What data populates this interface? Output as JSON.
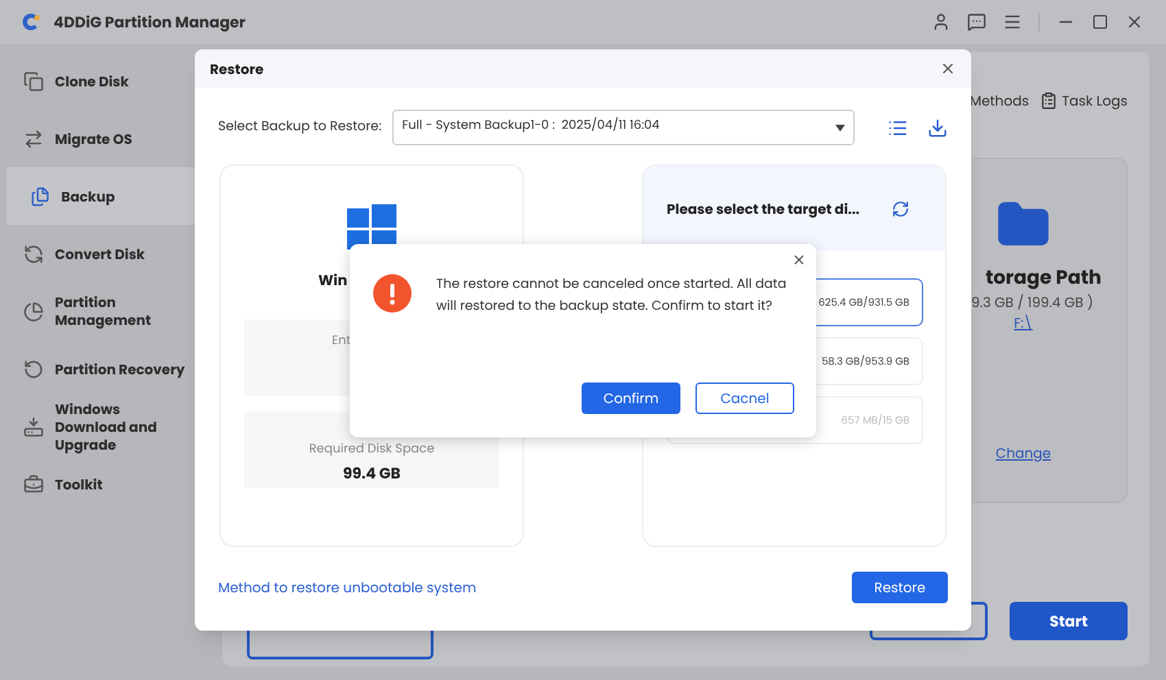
{
  "app": {
    "title": "4DDiG Partition Manager"
  },
  "sidebar": {
    "items": [
      {
        "label": "Clone Disk",
        "selected": false
      },
      {
        "label": "Migrate OS",
        "selected": false
      },
      {
        "label": "Backup",
        "selected": true
      },
      {
        "label": "Convert Disk",
        "selected": false
      },
      {
        "label": "Partition Management",
        "selected": false
      },
      {
        "label": "Partition Recovery",
        "selected": false
      },
      {
        "label": "Windows Download and Upgrade",
        "selected": false
      },
      {
        "label": "Toolkit",
        "selected": false
      }
    ]
  },
  "main": {
    "links": [
      "Methods",
      "Task Logs"
    ],
    "storage_card": {
      "title": "torage Path",
      "size": "9.3 GB / 199.4 GB )",
      "path": "F:\\",
      "change": "Change"
    },
    "start_button": "Start"
  },
  "restore_dialog": {
    "title": "Restore",
    "select_label": "Select Backup to Restore:",
    "select_value": "Full - System Backup1-0 :  2025/04/11 16:04",
    "system_card": {
      "os_label": "Win",
      "info": [
        {
          "label": "Ent"
        },
        {
          "label": "Required Disk Space",
          "value": "99.4 GB"
        }
      ]
    },
    "target_card": {
      "title": "Please select the target di...",
      "disks": [
        {
          "size": "625.4 GB/931.5 GB",
          "selected": true,
          "disabled": false
        },
        {
          "size": "58.3 GB/953.9 GB",
          "selected": false,
          "disabled": false
        },
        {
          "size": "657 MB/15 GB",
          "selected": false,
          "disabled": true
        }
      ]
    },
    "link": "Method to restore unbootable system",
    "restore_button": "Restore"
  },
  "confirm_dialog": {
    "message": "The restore cannot be canceled once started. All data will restored to the backup state. Confirm to start it?",
    "buttons": [
      {
        "label": "Confirm",
        "kind": "primary"
      },
      {
        "label": "Cacnel",
        "kind": "secondary"
      }
    ]
  }
}
